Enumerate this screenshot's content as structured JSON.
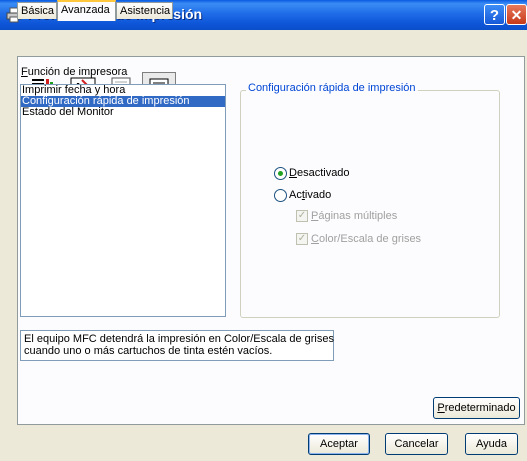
{
  "window": {
    "title": "Preferencias de impresión",
    "help_glyph": "?",
    "close_glyph": "✕",
    "title_icon": "printer-icon"
  },
  "tabs": [
    {
      "label": "Básica",
      "active": false
    },
    {
      "label": "Avanzada",
      "active": true
    },
    {
      "label": "Asistencia",
      "active": false
    }
  ],
  "toolbar_icons": [
    {
      "name": "print-quality-icon",
      "pressed": false
    },
    {
      "name": "font-scale-icon",
      "pressed": false
    },
    {
      "name": "copy-watermark-icon",
      "pressed": false
    },
    {
      "name": "device-options-icon",
      "pressed": true
    }
  ],
  "function_list": {
    "label_prefix": "",
    "label_accel": "F",
    "label_rest": "unción de impresora",
    "items": [
      {
        "label": "Imprimir fecha y hora",
        "selected": false
      },
      {
        "label": "Configuración rápida de impresión",
        "selected": true
      },
      {
        "label": "Estado del Monitor",
        "selected": false
      }
    ]
  },
  "quick_setup": {
    "group_title": "Configuración rápida de impresión",
    "off": {
      "accel": "D",
      "rest": "esactivado",
      "selected": true
    },
    "on": {
      "pre": "Ac",
      "accel": "t",
      "rest": "ivado",
      "selected": false
    },
    "multi_pages": {
      "accel": "P",
      "rest": "áginas múltiples",
      "checked": true,
      "enabled": false
    },
    "color_gray": {
      "accel": "C",
      "rest": "olor/Escala de grises",
      "checked": true,
      "enabled": false
    }
  },
  "status_message": {
    "line1": "El equipo MFC detendrá la impresión en Color/Escala de grises",
    "line2": "cuando uno o más cartuchos de tinta estén vacíos."
  },
  "buttons": {
    "default_accel": "P",
    "default_rest": "redeterminado",
    "accept": "Aceptar",
    "cancel": "Cancelar",
    "help": "Ayuda"
  },
  "colors": {
    "titlebar": "#0a5ae0",
    "selection": "#316ac5",
    "group_title": "#0046d5",
    "dialog_bg": "#ece9d8"
  }
}
